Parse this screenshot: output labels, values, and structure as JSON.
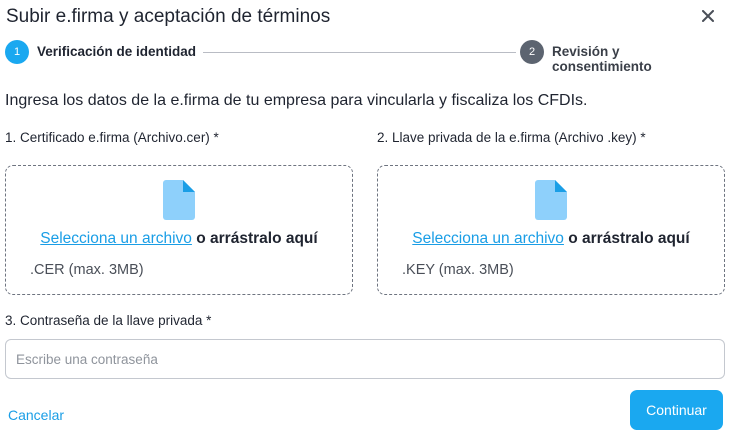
{
  "dialog": {
    "title": "Subir e.firma y aceptación de términos",
    "close_icon": "close-icon"
  },
  "stepper": {
    "steps": [
      {
        "number": "1",
        "label": "Verificación de identidad",
        "state": "active",
        "color": "#1aa8f0"
      },
      {
        "number": "2",
        "label": "Revisión y consentimiento",
        "state": "inactive",
        "color": "#5c6470"
      }
    ]
  },
  "intro": "Ingresa los datos de la e.firma de tu empresa para vincularla y fiscaliza los CFDIs.",
  "uploads": [
    {
      "label": "1. Certificado e.firma (Archivo.cer) *",
      "icon": "file-icon",
      "link": "Selecciona un archivo",
      "rest": " o arrástralo aquí",
      "hint": ".CER (max. 3MB)"
    },
    {
      "label": "2. Llave privada de la e.firma (Archivo .key) *",
      "icon": "file-icon",
      "link": "Selecciona un archivo",
      "rest": " o arrástralo aquí",
      "hint": ".KEY (max. 3MB)"
    }
  ],
  "password": {
    "label": "3. Contraseña de la llave privada *",
    "placeholder": "Escribe una contraseña",
    "value": ""
  },
  "footer": {
    "cancel_label": "Cancelar",
    "continue_label": "Continuar"
  },
  "colors": {
    "accent": "#1aa8f0",
    "link": "#1a9ee6",
    "file_icon": "#8ed0fb"
  }
}
